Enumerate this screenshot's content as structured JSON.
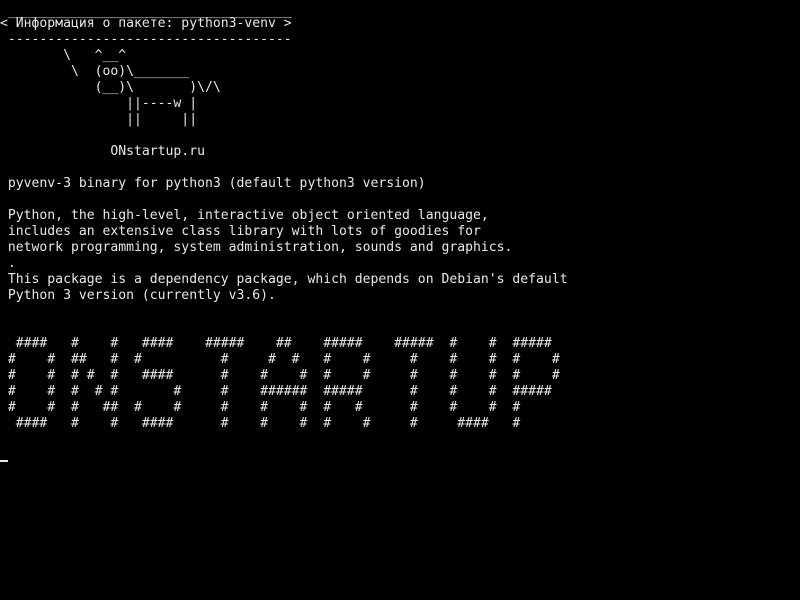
{
  "terminal": {
    "banner_top": " ____________________________________",
    "banner_title": "< Информация о пакете: python3-venv >",
    "banner_bottom": " ------------------------------------",
    "cow": [
      "        \\   ^__^",
      "         \\  (oo)\\_______",
      "            (__)\\       )\\/\\",
      "                ||----w |",
      "                ||     ||"
    ],
    "site": "              ONstartup.ru",
    "description": [
      " pyvenv-3 binary for python3 (default python3 version)",
      "",
      " Python, the high-level, interactive object oriented language,",
      " includes an extensive class library with lots of goodies for",
      " network programming, system administration, sounds and graphics.",
      " .",
      " This package is a dependency package, which depends on Debian's default",
      " Python 3 version (currently v3.6)."
    ],
    "figlet": [
      "  ####   #    #   ####    #####    ##    #####    #####  #    #  #####",
      " #    #  ##   #  #          #     #  #   #    #     #    #    #  #    #",
      " #    #  # #  #   ####      #    #    #  #    #     #    #    #  #    #",
      " #    #  #  # #       #     #    ######  #####      #    #    #  #####",
      " #    #  #   ##  #    #     #    #    #  #   #      #    #    #  #",
      "  ####   #    #   ####      #    #    #  #    #     #     ####   #"
    ]
  }
}
